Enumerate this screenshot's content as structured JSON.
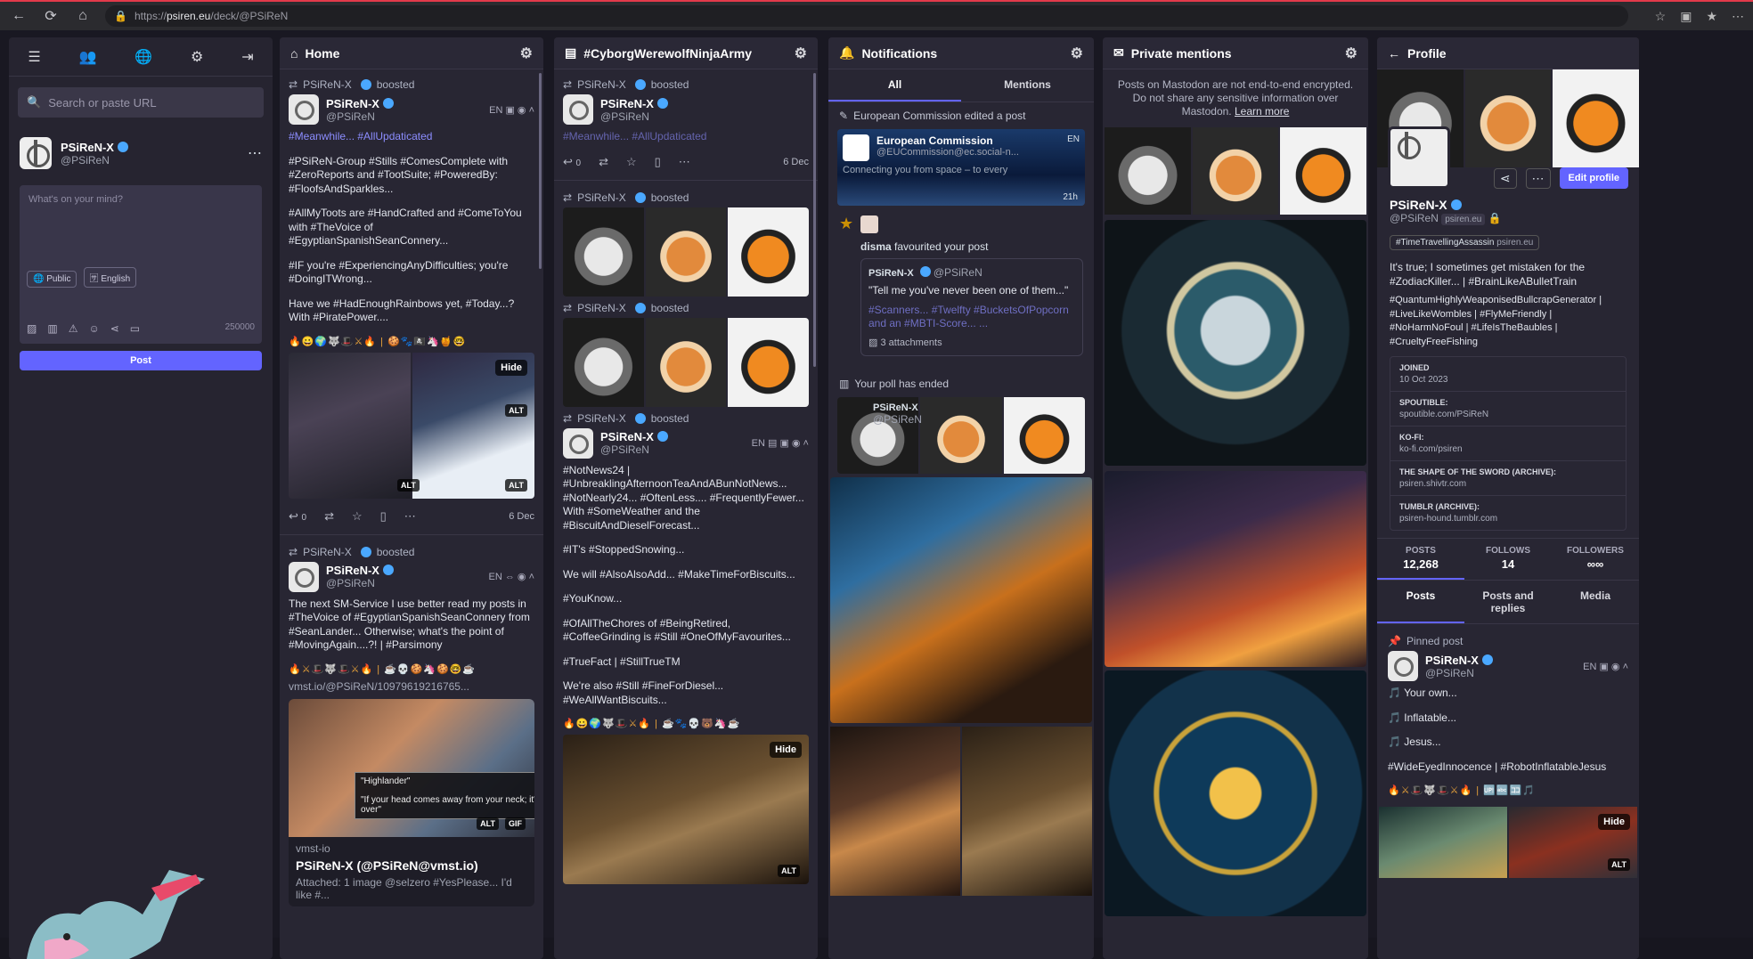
{
  "browser": {
    "url_prefix": "https://",
    "url_host": "psiren.eu",
    "url_path": "/deck/@PSiReN"
  },
  "sidebar": {
    "search_placeholder": "Search or paste URL",
    "account": {
      "name": "PSiReN-X",
      "handle": "@PSiReN"
    },
    "compose": {
      "placeholder": "What's on your mind?",
      "visibility": "Public",
      "language": "English",
      "char_count": "250000",
      "post_label": "Post"
    }
  },
  "home": {
    "title": "Home",
    "posts": [
      {
        "booster": "PSiReN-X",
        "boosted": "boosted",
        "name": "PSiReN-X",
        "handle": "@PSiReN",
        "lang": "EN",
        "p1": "#Meanwhile... #AllUpdaticated",
        "p2": "#PSiReN-Group #Stills #ComesComplete with #ZeroReports and #TootSuite; #PoweredBy: #FloofsAndSparkles...",
        "p3": "#AllMyToots are #HandCrafted and #ComeToYou with #TheVoice of #EgyptianSpanishSeanConnery...",
        "p4": "#IF you're #ExperiencingAnyDifficulties; you're #DoingITWrong...",
        "p5": "Have we #HadEnoughRainbows yet, #Today...? With #PiratePower....",
        "hide": "Hide",
        "alt": "ALT",
        "replies": "0",
        "date": "6 Dec"
      },
      {
        "booster": "PSiReN-X",
        "boosted": "boosted",
        "name": "PSiReN-X",
        "handle": "@PSiReN",
        "lang": "EN",
        "p1": "The next SM-Service I use better read my posts in #TheVoice of #EgyptianSpanishSeanConnery from #SeanLander... Otherwise; what's the point of #MovingAgain....?! | #Parsimony",
        "link": "vmst.io/@PSiReN/10979619216765...",
        "tooltip_title": "\"Highlander\"",
        "tooltip_text": "\"If your head comes away from your neck; it's over\"",
        "gif": "GIF",
        "card_site": "vmst-io",
        "card_title": "PSiReN-X (@PSiReN@vmst.io)",
        "card_desc": "Attached: 1 image @selzero #YesPlease... I'd like #..."
      }
    ]
  },
  "cyborg": {
    "title": "#CyborgWerewolfNinjaArmy",
    "posts": [
      {
        "booster": "PSiReN-X",
        "boosted": "boosted",
        "name": "PSiReN-X",
        "handle": "@PSiReN",
        "p1": "#Meanwhile... #AllUpdaticated",
        "date": "6 Dec",
        "replies": "0"
      },
      {
        "booster": "PSiReN-X",
        "boosted": "boosted",
        "name": "PSiReN-X",
        "handle": "@PSiReN"
      },
      {
        "booster": "PSiReN-X",
        "boosted": "boosted",
        "name": "PSiReN-X",
        "handle": "@PSiReN"
      },
      {
        "booster": "PSiReN-X",
        "boosted": "boosted",
        "name": "PSiReN-X",
        "handle": "@PSiReN",
        "lang": "EN",
        "p1": "#NotNews24 | #UnbreaklingAfternoonTeaAndABunNotNews... #NotNearly24... #OftenLess.... #FrequentlyFewer... With #SomeWeather and the #BiscuitAndDieselForecast...",
        "p2": "#IT's #StoppedSnowing...",
        "p3": "We will #AlsoAlsoAdd... #MakeTimeForBiscuits...",
        "p4": "#YouKnow...",
        "p5": "#OfAllTheChores of #BeingRetired, #CoffeeGrinding is #Still #OneOfMyFavourites...",
        "p6": "#TrueFact | #StillTrueTM",
        "p7": "We're also #Still #FineForDiesel... #WeAllWantBiscuits...",
        "hide": "Hide",
        "alt": "ALT"
      }
    ]
  },
  "notifications": {
    "title": "Notifications",
    "tab_all": "All",
    "tab_mentions": "Mentions",
    "edit_notice": "European Commission edited a post",
    "ec_name": "European Commission",
    "ec_handle": "@EUCommission@ec.social-n...",
    "ec_lang": "EN",
    "ec_text": "Connecting you from space – to every",
    "ec_time": "21h",
    "fav_user": "disma",
    "fav_text": "favourited your post",
    "q_name": "PSiReN-X",
    "q_handle": "@PSiReN",
    "q_text1": "\"Tell me you've never been one of them...\"",
    "q_text2": "#Scanners... #Twelfty #BucketsOfPopcorn and an #MBTI-Score... ...",
    "q_attach": "3 attachments",
    "poll_notice": "Your poll has ended",
    "poll_name": "PSiReN-X",
    "poll_handle": "@PSiReN"
  },
  "private": {
    "title": "Private mentions",
    "notice": "Posts on Mastodon are not end-to-end encrypted. Do not share any sensitive information over Mastodon.",
    "learn_more": "Learn more"
  },
  "profile": {
    "title": "Profile",
    "edit_label": "Edit profile",
    "name": "PSiReN-X",
    "handle": "@PSiReN",
    "domain_badge": "psiren.eu",
    "featured_tag": "#TimeTravellingAssassin",
    "featured_domain": "psiren.eu",
    "bio1": "It's true; I sometimes get mistaken for the #ZodiacKiller... | #BrainLikeABulletTrain",
    "bio2": "#QuantumHighlyWeaponisedBullcrapGenerator | #LiveLikeWombles | #FlyMeFriendly | #NoHarmNoFoul | #LifeIsTheBaubles | #CrueltyFreeFishing",
    "fields": [
      {
        "k": "JOINED",
        "v": "10 Oct 2023"
      },
      {
        "k": "SPOUTIBLE:",
        "v": "spoutible.com/PSiReN"
      },
      {
        "k": "KO-FI:",
        "v": "ko-fi.com/psiren"
      },
      {
        "k": "THE SHAPE OF THE SWORD (ARCHIVE):",
        "v": "psiren.shivtr.com"
      },
      {
        "k": "TUMBLR (ARCHIVE):",
        "v": "psiren-hound.tumblr.com"
      }
    ],
    "posts_label": "POSTS",
    "posts_count": "12,268",
    "follows_label": "FOLLOWS",
    "follows_count": "14",
    "followers_label": "FOLLOWERS",
    "followers_count": "∞∞",
    "tab_posts": "Posts",
    "tab_replies": "Posts and replies",
    "tab_media": "Media",
    "pinned": "Pinned post",
    "pin_name": "PSiReN-X",
    "pin_handle": "@PSiReN",
    "pin_lang": "EN",
    "pin_l1": "Your own...",
    "pin_l2": "Inflatable...",
    "pin_l3": "Jesus...",
    "pin_tags": "#WideEyedInnocence | #RobotInflatableJesus",
    "hide": "Hide",
    "alt": "ALT"
  }
}
